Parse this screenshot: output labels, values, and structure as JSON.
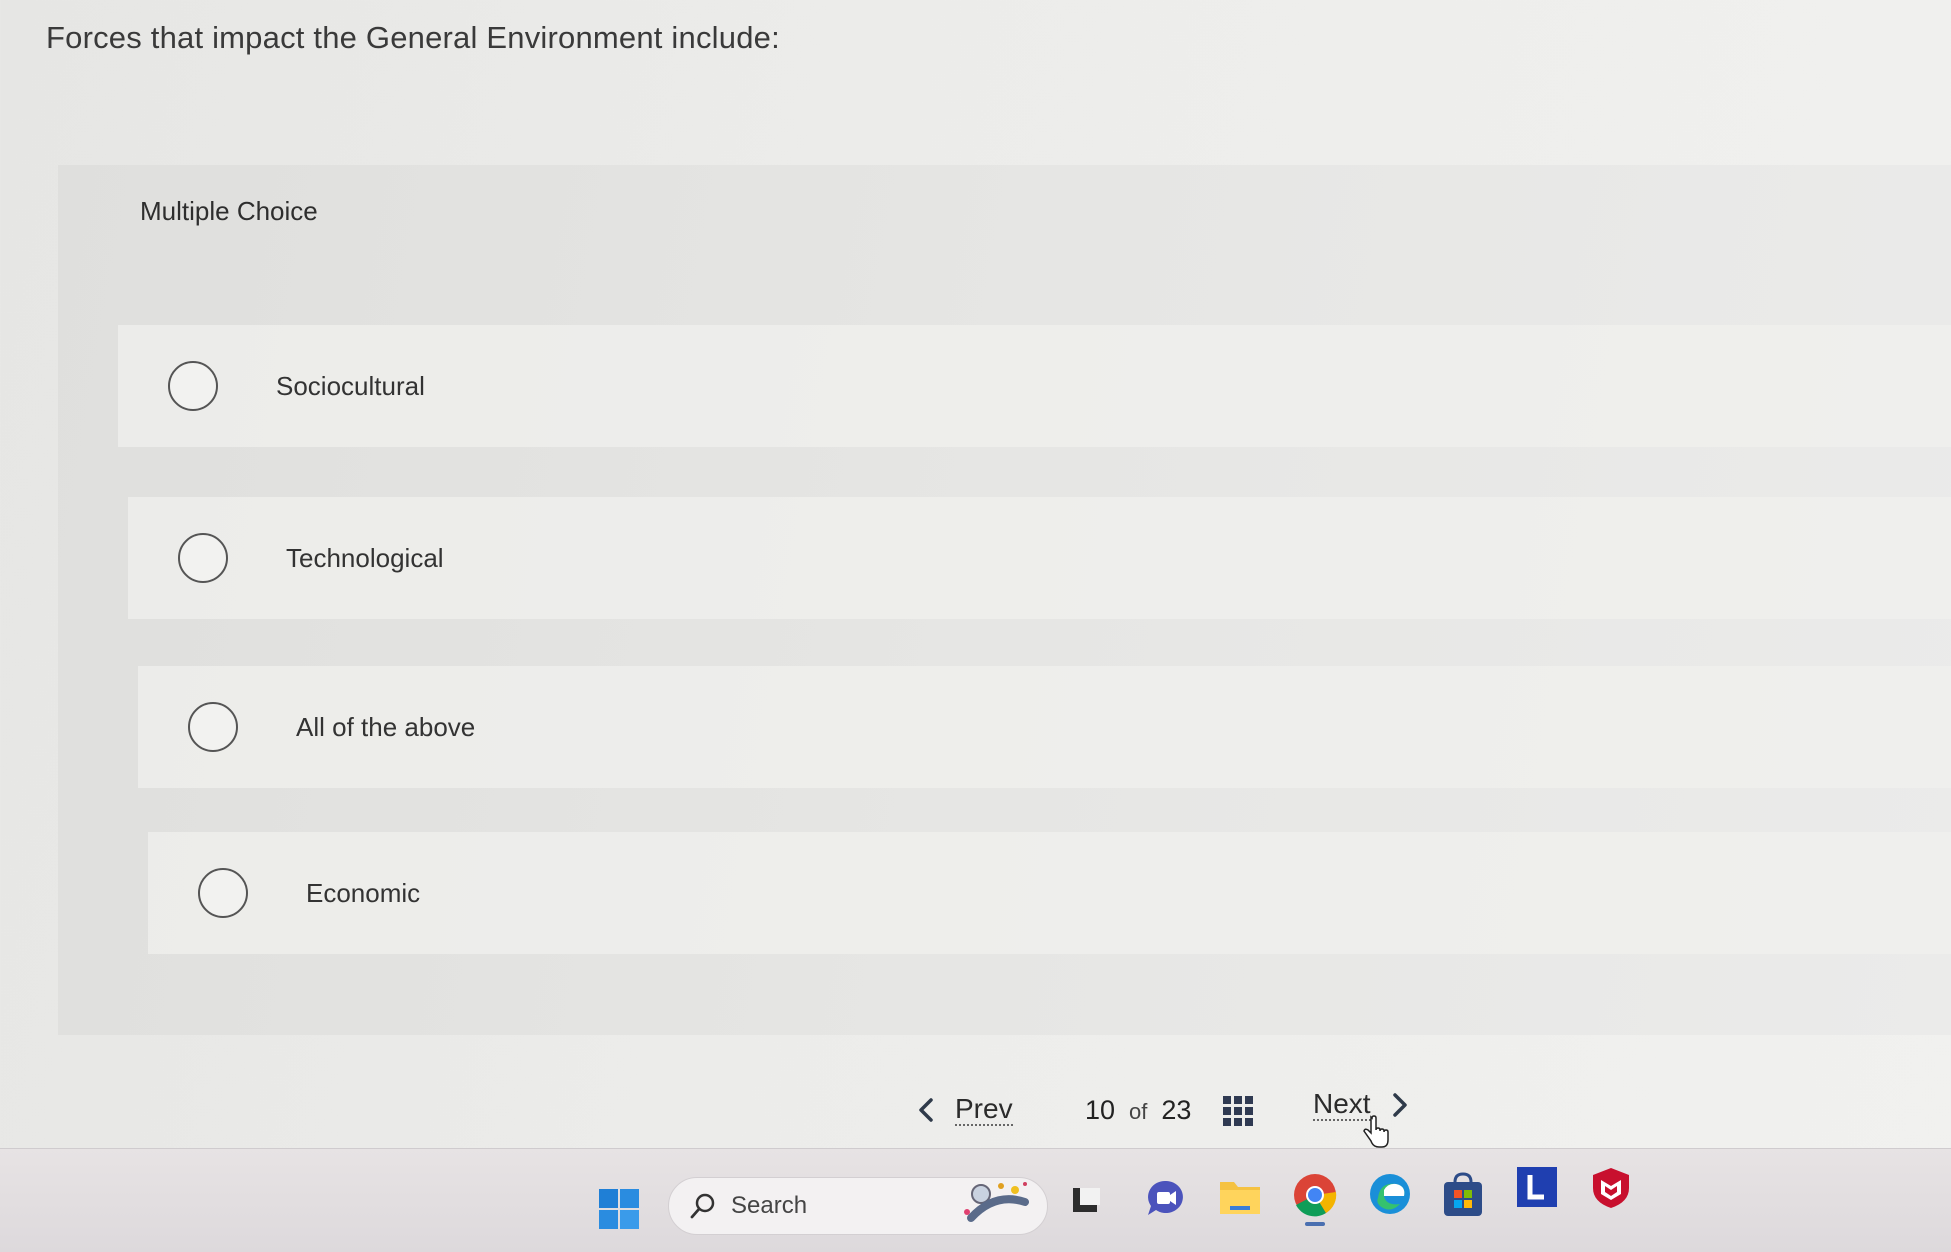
{
  "question": {
    "text": "Forces that impact the General Environment include:"
  },
  "panel": {
    "label": "Multiple Choice"
  },
  "options": [
    {
      "label": "Sociocultural"
    },
    {
      "label": "Technological"
    },
    {
      "label": "All of the above"
    },
    {
      "label": "Economic"
    }
  ],
  "nav": {
    "prev_label": "Prev",
    "current": "10",
    "of_label": "of",
    "total": "23",
    "next_label": "Next"
  },
  "taskbar": {
    "search_label": "Search",
    "icons": [
      "windows-start-icon",
      "search-icon",
      "widgets-icon",
      "task-view-icon",
      "chat-icon",
      "file-explorer-icon",
      "chrome-icon",
      "edge-icon",
      "store-icon",
      "l-app-icon",
      "mcafee-icon"
    ]
  },
  "colors": {
    "accent_text": "#2b2b2b",
    "radio_border": "#555555",
    "taskbar_bg": "#e2dee0"
  }
}
